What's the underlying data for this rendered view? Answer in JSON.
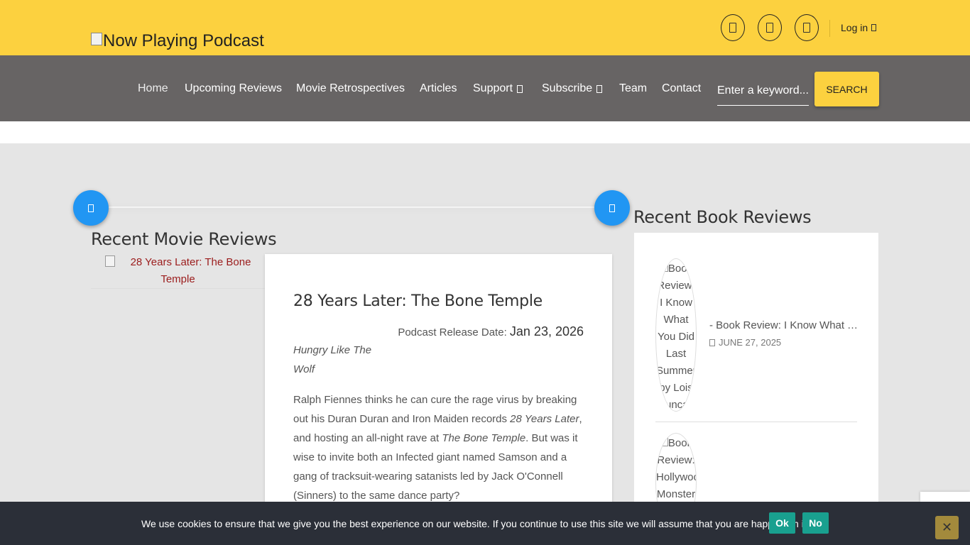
{
  "header": {
    "logo_text": "Now Playing Podcast",
    "social_icons": [
      "facebook-icon",
      "twitter-icon",
      "instagram-icon"
    ],
    "login_label": "Log in"
  },
  "nav": {
    "items": [
      {
        "label": "Home",
        "active": true
      },
      {
        "label": "Upcoming Reviews"
      },
      {
        "label": "Movie Retrospectives"
      },
      {
        "label": "Articles"
      },
      {
        "label": "Support",
        "dropdown": true
      },
      {
        "label": "Subscribe",
        "dropdown": true
      },
      {
        "label": "Team"
      },
      {
        "label": "Contact"
      }
    ],
    "search_placeholder": "Enter a keyword...",
    "search_button": "SEARCH"
  },
  "movies": {
    "section_title": "Recent Movie Reviews",
    "thumb_alt": "28 Years Later: The Bone Temple",
    "card": {
      "title": "28 Years Later: The Bone Temple",
      "release_label": "Podcast Release Date:",
      "release_date": "Jan 23, 2026",
      "tagline": "Hungry Like The Wolf",
      "body_1": "Ralph Fiennes thinks he can cure the rage virus by breaking out his Duran Duran and Iron Maiden records ",
      "body_em_1": "28 Years Later",
      "body_2": ", and hosting an all-night rave at ",
      "body_em_2": "The Bone Temple",
      "body_3": ". But was it wise to invite both an Infected giant named Samson and a gang of tracksuit-wearing satanists led by Jack O'Connell (Sinners) to the same dance party?"
    }
  },
  "books": {
    "section_title": "Recent Book Reviews",
    "items": [
      {
        "img_alt": "Book Review: I Know What You Did Last Summer by Lois Duncan",
        "title": "- Book Review: I Know What You Did Last Summer by Lois Duncan",
        "date": "JUNE 27, 2025"
      },
      {
        "img_alt": "Book Review: Hollywood Monster",
        "title": "",
        "date": ""
      }
    ]
  },
  "cookie": {
    "text": "We use cookies to ensure that we give you the best experience on our website. If you continue to use this site we will assume that you are happy with it.",
    "ok_label": "Ok",
    "no_label": "No",
    "close_label": "✕"
  }
}
